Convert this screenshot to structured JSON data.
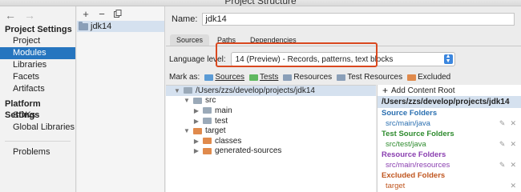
{
  "window": {
    "title": "Project Structure"
  },
  "nav": {
    "back_icon": "arrow-left-icon",
    "forward_icon": "arrow-right-icon",
    "sections": [
      {
        "title": "Project Settings",
        "items": [
          "Project",
          "Modules",
          "Libraries",
          "Facets",
          "Artifacts"
        ]
      },
      {
        "title": "Platform Settings",
        "items": [
          "SDKs",
          "Global Libraries"
        ]
      }
    ],
    "selected": "Modules",
    "problems": "Problems"
  },
  "modules": {
    "toolbar": {
      "add": "+",
      "remove": "−",
      "copy_icon": "copy-icon"
    },
    "items": [
      "jdk14"
    ]
  },
  "detail": {
    "name_label": "Name:",
    "name_value": "jdk14",
    "tabs": [
      "Sources",
      "Paths",
      "Dependencies"
    ],
    "selected_tab": "Sources",
    "language_label": "Language level:",
    "language_value": "14 (Preview) - Records, patterns, text blocks",
    "mark_as_label": "Mark as:",
    "marks": [
      {
        "label": "Sources",
        "color": "#5b9bd5"
      },
      {
        "label": "Tests",
        "color": "#5fb85f"
      },
      {
        "label": "Resources",
        "color": "#8a9fb8"
      },
      {
        "label": "Test Resources",
        "color": "#8a9fb8"
      },
      {
        "label": "Excluded",
        "color": "#e08a4c"
      }
    ],
    "tree": [
      {
        "label": "/Users/zzs/develop/projects/jdk14",
        "depth": 0,
        "expanded": true
      },
      {
        "label": "src",
        "depth": 1,
        "expanded": true
      },
      {
        "label": "main",
        "depth": 2,
        "expanded": false
      },
      {
        "label": "test",
        "depth": 2,
        "expanded": false
      },
      {
        "label": "target",
        "depth": 1,
        "expanded": true
      },
      {
        "label": "classes",
        "depth": 2,
        "expanded": false
      },
      {
        "label": "generated-sources",
        "depth": 2,
        "expanded": false
      }
    ],
    "content_roots": {
      "add_label": "Add Content Root",
      "root_path": "/Users/zzs/develop/projects/jdk14",
      "groups": [
        {
          "title": "Source Folders",
          "path": "src/main/java",
          "color": "#2a6fb0"
        },
        {
          "title": "Test Source Folders",
          "path": "src/test/java",
          "color": "#2e8b2e"
        },
        {
          "title": "Resource Folders",
          "path": "src/main/resources",
          "color": "#8a3fb0"
        },
        {
          "title": "Excluded Folders",
          "path": "target",
          "color": "#c0561f"
        }
      ]
    }
  },
  "colors": {
    "selection": "#2675bf",
    "highlight_border": "#d9481f",
    "select_arrow": "#3b86de"
  }
}
